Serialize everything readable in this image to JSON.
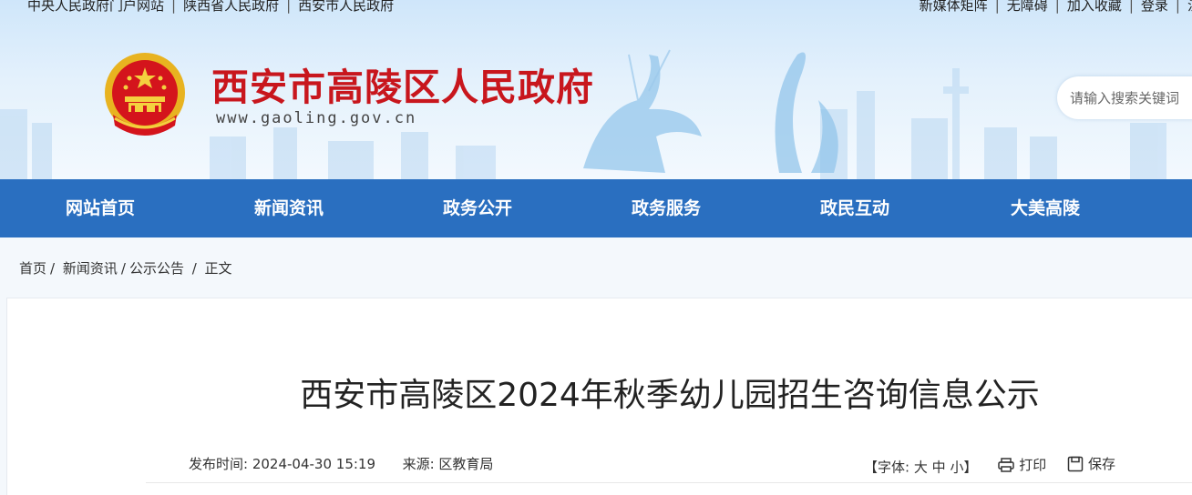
{
  "topbar": {
    "links_left": [
      "中央人民政府门户网站",
      "陕西省人民政府",
      "西安市人民政府"
    ],
    "links_right": [
      "新媒体矩阵",
      "无障碍",
      "加入收藏",
      "登录",
      "注"
    ]
  },
  "header": {
    "title": "西安市高陵区人民政府",
    "url": "www.gaoling.gov.cn",
    "search_placeholder": "请输入搜索关键词"
  },
  "nav": [
    "网站首页",
    "新闻资讯",
    "政务公开",
    "政务服务",
    "政民互动",
    "大美高陵"
  ],
  "breadcrumb": [
    "首页",
    "新闻资讯",
    "公示公告",
    "正文"
  ],
  "article": {
    "title": "西安市高陵区2024年秋季幼儿园招生咨询信息公示",
    "publish_label": "发布时间:",
    "publish_time": "2024-04-30 15:19",
    "source_label": "来源:",
    "source": "区教育局"
  },
  "tools": {
    "font_open": "【字体:",
    "font_large": "大",
    "font_medium": "中",
    "font_small": "小",
    "font_close": "】",
    "print": "打印",
    "save": "保存"
  },
  "colors": {
    "nav_bg": "#2a6fc0",
    "title_red": "#c8161d"
  }
}
